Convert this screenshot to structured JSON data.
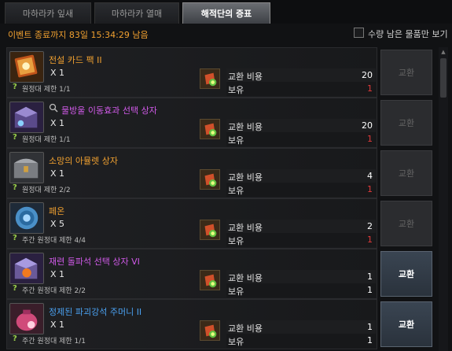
{
  "tabs": [
    {
      "label": "마하라카 잎새"
    },
    {
      "label": "마하라카 열매"
    },
    {
      "label": "해적단의 증표"
    }
  ],
  "timer": "이벤트 종료까지 83일 15:34:29 남음",
  "filter_label": "수량 남은 물품만 보기",
  "cost_label": "교환 비용",
  "own_label": "보유",
  "button_label": "교환",
  "items": [
    {
      "name": "전설 카드 팩 II",
      "name_color": "#f0a030",
      "qty": "X 1",
      "limit": "원정대 제한 1/1",
      "cost": "20",
      "own": "1",
      "own_ok": false,
      "enabled": false
    },
    {
      "name": "물방울 이동효과 선택 상자",
      "name_color": "#d05ae8",
      "qty": "X 1",
      "limit": "원정대 제한 1/1",
      "cost": "20",
      "own": "1",
      "own_ok": false,
      "enabled": false,
      "searchable": true
    },
    {
      "name": "소망의 아뮬렛 상자",
      "name_color": "#f0a030",
      "qty": "X 1",
      "limit": "원정대 제한 2/2",
      "cost": "4",
      "own": "1",
      "own_ok": false,
      "enabled": false
    },
    {
      "name": "페온",
      "name_color": "#f0a030",
      "qty": "X 5",
      "limit": "주간 원정대 제한 4/4",
      "cost": "2",
      "own": "1",
      "own_ok": false,
      "enabled": false
    },
    {
      "name": "재련 돌파석 선택 상자 VI",
      "name_color": "#d05ae8",
      "qty": "X 1",
      "limit": "주간 원정대 제한 2/2",
      "cost": "1",
      "own": "1",
      "own_ok": true,
      "enabled": true
    },
    {
      "name": "정제된 파괴강석 주머니 II",
      "name_color": "#4aa0f0",
      "qty": "X 1",
      "limit": "주간 원정대 제한 1/1",
      "cost": "1",
      "own": "1",
      "own_ok": true,
      "enabled": true
    }
  ]
}
